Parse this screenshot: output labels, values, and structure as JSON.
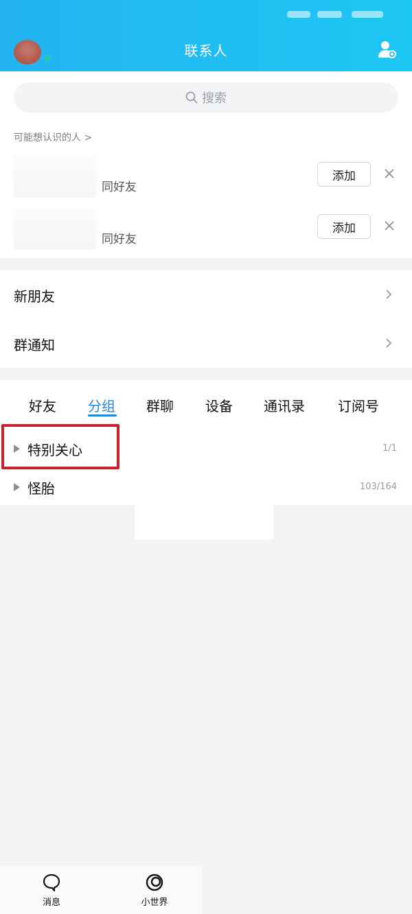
{
  "header": {
    "title": "联系人",
    "add_contact_icon": "person-add-icon",
    "brand_color": "#23b4f0"
  },
  "search": {
    "placeholder": "搜索"
  },
  "suggestions": {
    "title": "可能想认识的人 >",
    "items": [
      {
        "label": "同好友",
        "add_label": "添加"
      },
      {
        "label": "同好友",
        "add_label": "添加"
      }
    ]
  },
  "menu": {
    "items": [
      {
        "label": "新朋友"
      },
      {
        "label": "群通知"
      }
    ]
  },
  "tabs": {
    "items": [
      "好友",
      "分组",
      "群聊",
      "设备",
      "通讯录",
      "订阅号"
    ],
    "active": "分组",
    "active_color": "#1e88e5"
  },
  "groups": [
    {
      "name": "特别关心",
      "count": "1/1"
    },
    {
      "name": "怪胎",
      "count": "103/164"
    }
  ],
  "bottom_nav": {
    "items": [
      {
        "label": "消息",
        "icon": "chat-bubble-icon"
      },
      {
        "label": "小世界",
        "icon": "world-circle-icon"
      }
    ]
  },
  "highlight_color": "#c8232d"
}
